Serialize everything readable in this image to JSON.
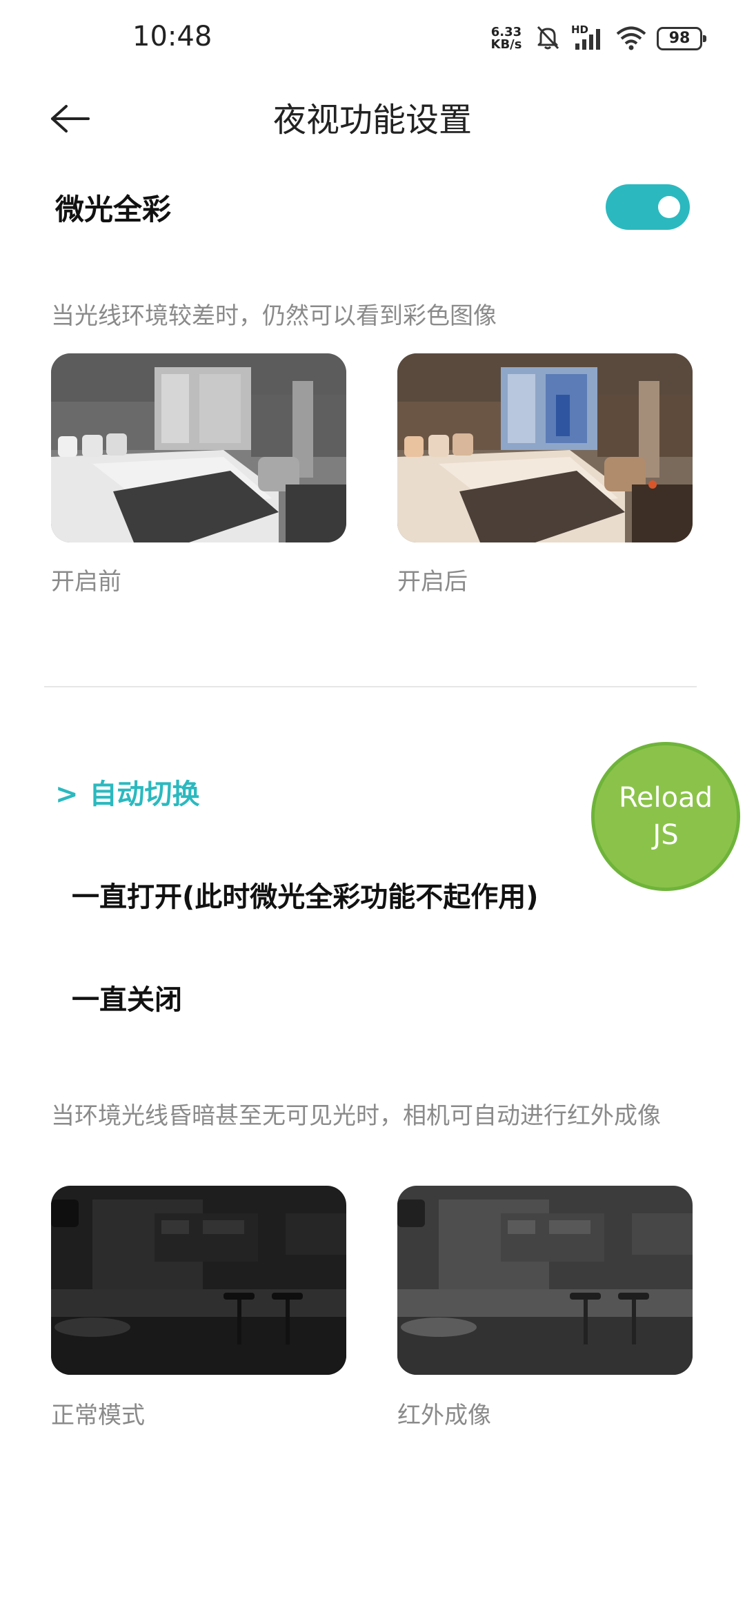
{
  "status_bar": {
    "time": "10:48",
    "net_speed_value": "6.33",
    "net_speed_unit": "KB/s",
    "signal_label": "HD",
    "battery": "98"
  },
  "nav": {
    "title": "夜视功能设置"
  },
  "low_light_color": {
    "label": "微光全彩",
    "enabled": true,
    "accent_color": "#2bb9bf",
    "description": "当光线环境较差时，仍然可以看到彩色图像",
    "before_caption": "开启前",
    "after_caption": "开启后"
  },
  "infrared": {
    "options": [
      {
        "marker": ">",
        "label": "自动切换",
        "selected": true
      },
      {
        "marker": "",
        "label": "一直打开(此时微光全彩功能不起作用)",
        "selected": false
      },
      {
        "marker": "",
        "label": "一直关闭",
        "selected": false
      }
    ],
    "description": "当环境光线昏暗甚至无可见光时，相机可自动进行红外成像",
    "normal_caption": "正常模式",
    "ir_caption": "红外成像"
  },
  "reload": {
    "label": "Reload JS",
    "color": "#8bc34a"
  }
}
